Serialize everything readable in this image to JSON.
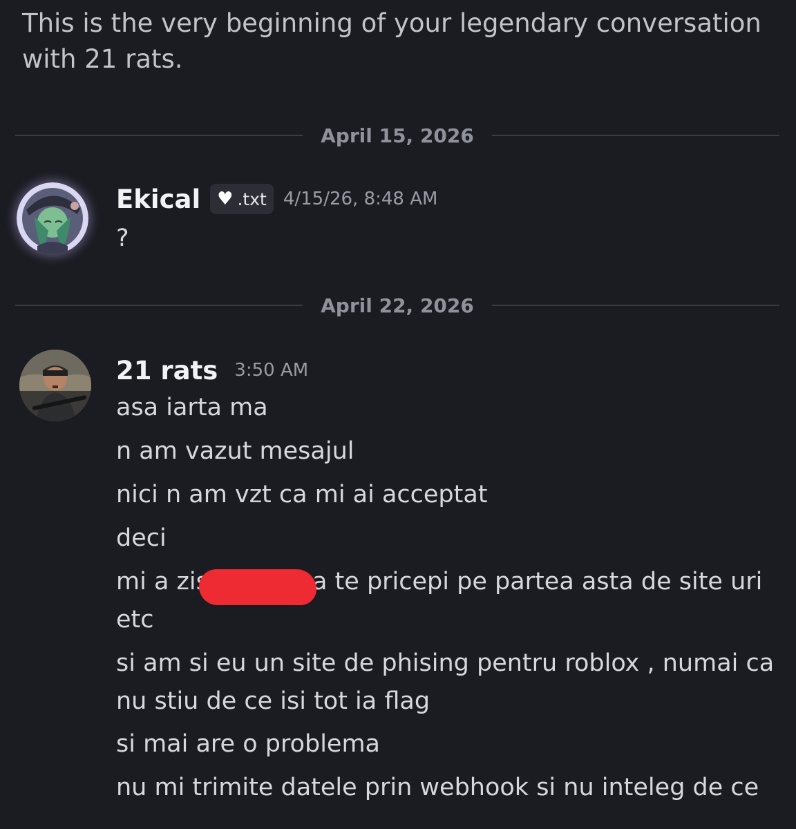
{
  "intro": {
    "text": "This is the very beginning of your legendary conversation with 21 rats."
  },
  "dividers": [
    {
      "date": "April 15, 2026"
    },
    {
      "date": "April 22, 2026"
    }
  ],
  "messages": [
    {
      "username": "Ekical",
      "tag": ".txt",
      "tag_icon": "white-heart-icon",
      "timestamp": "4/15/26, 8:48 AM",
      "lines": [
        "?"
      ]
    },
    {
      "username": "21 rats",
      "timestamp": "3:50 AM",
      "lines": [
        "asa iarta ma",
        "n am vazut mesajul",
        "nici n am vzt ca mi ai acceptat",
        "deci",
        "mi a zis",
        "a te pricepi pe partea asta de site uri",
        "etc",
        "si am si eu un site de phising pentru roblox , numai ca nu stiu de ce isi tot ia flag",
        "si mai are o problema",
        "nu mi trimite datele prin webhook si nu inteleg de ce"
      ]
    }
  ],
  "colors": {
    "background": "#1b1b22",
    "redaction": "#ee2a33"
  }
}
